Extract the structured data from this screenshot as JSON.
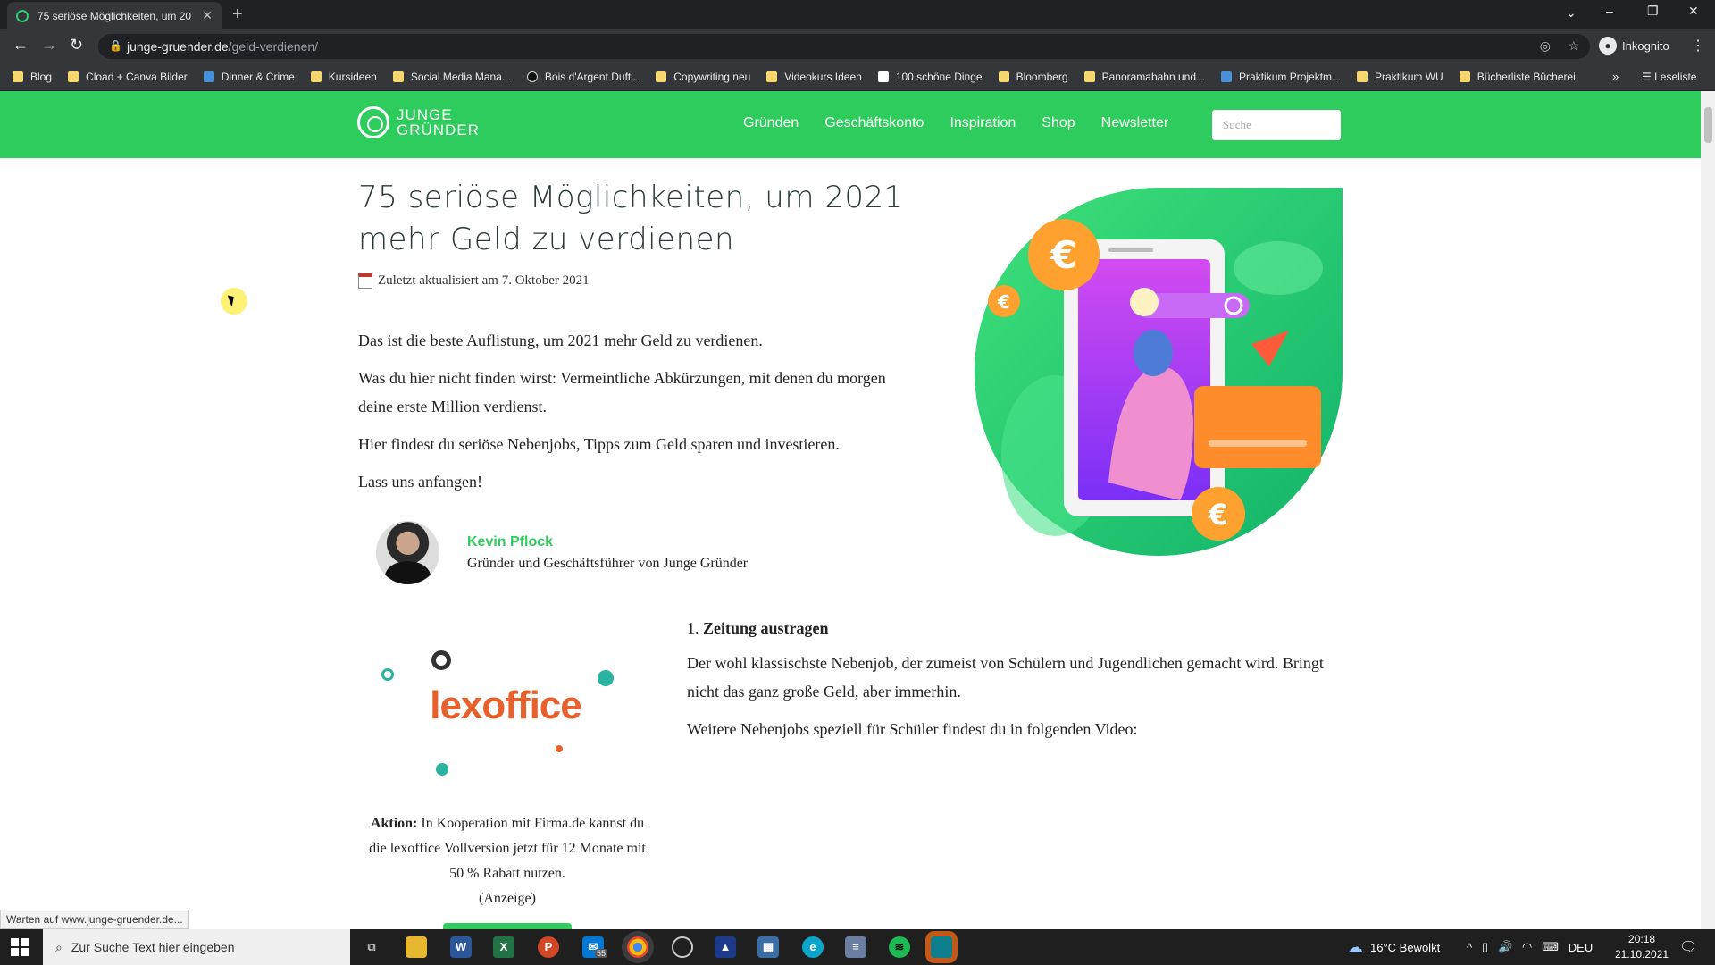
{
  "browser": {
    "tab_title": "75 seriöse Möglichkeiten, um 20",
    "url_host": "junge-gruender.de",
    "url_path": "/geld-verdienen/",
    "incognito_label": "Inkognito",
    "bookmarks": [
      {
        "label": "Blog",
        "icon": "folder-icon"
      },
      {
        "label": "Cload + Canva Bilder",
        "icon": "folder-icon"
      },
      {
        "label": "Dinner & Crime",
        "icon": "site-icon"
      },
      {
        "label": "Kursideen",
        "icon": "folder-icon"
      },
      {
        "label": "Social Media Mana...",
        "icon": "folder-icon"
      },
      {
        "label": "Bois d'Argent Duft...",
        "icon": "site-icon"
      },
      {
        "label": "Copywriting neu",
        "icon": "folder-icon"
      },
      {
        "label": "Videokurs Ideen",
        "icon": "folder-icon"
      },
      {
        "label": "100 schöne Dinge",
        "icon": "site-icon"
      },
      {
        "label": "Bloomberg",
        "icon": "folder-icon"
      },
      {
        "label": "Panoramabahn und...",
        "icon": "folder-icon"
      },
      {
        "label": "Praktikum Projektm...",
        "icon": "site-icon"
      },
      {
        "label": "Praktikum WU",
        "icon": "folder-icon"
      },
      {
        "label": "Bücherliste Bücherei",
        "icon": "folder-icon"
      }
    ],
    "reading_list_label": "Leseliste",
    "status_text": "Warten auf www.junge-gruender.de..."
  },
  "site": {
    "logo_line1": "JUNGE",
    "logo_line2": "GRÜNDER",
    "nav": [
      "Gründen",
      "Geschäftskonto",
      "Inspiration",
      "Shop",
      "Newsletter"
    ],
    "search_placeholder": "Suche"
  },
  "article": {
    "title": "75 seriöse Möglichkeiten, um 2021 mehr Geld zu verdienen",
    "updated": "Zuletzt aktualisiert am 7. Oktober 2021",
    "paragraphs": [
      "Das ist die beste Auflistung, um 2021 mehr Geld zu verdienen.",
      "Was du hier nicht finden wirst: Vermeintliche Abkürzungen, mit denen du morgen deine erste Million verdienst.",
      "Hier findest du seriöse Nebenjobs, Tipps zum Geld sparen und investieren.",
      "Lass uns anfangen!"
    ],
    "author_name": "Kevin Pflock",
    "author_role": "Gründer und Geschäftsführer von Junge Gründer",
    "ad_logo": "lexoffice",
    "ad_bold": "Aktion:",
    "ad_text": "In Kooperation mit Firma.de kannst du die lexoffice Vollversion jetzt für 12 Monate mit 50 % Rabatt nutzen.",
    "ad_note": "(Anzeige)",
    "section_number": "1.",
    "section_title": "Zeitung austragen",
    "section_p1": "Der wohl klassischste Nebenjob, der zumeist von Schülern und Jugendlichen gemacht wird. Bringt nicht das ganz große Geld, aber immerhin.",
    "section_p2": "Weitere Nebenjobs speziell für Schüler findest du in folgenden Video:"
  },
  "taskbar": {
    "search_placeholder": "Zur Suche Text hier eingeben",
    "mail_badge": "55",
    "weather": "16°C  Bewölkt",
    "lang": "DEU",
    "time": "20:18",
    "date": "21.10.2021"
  },
  "colors": {
    "brand_green": "#2ecc5c",
    "lexoffice_orange": "#e8602c"
  }
}
